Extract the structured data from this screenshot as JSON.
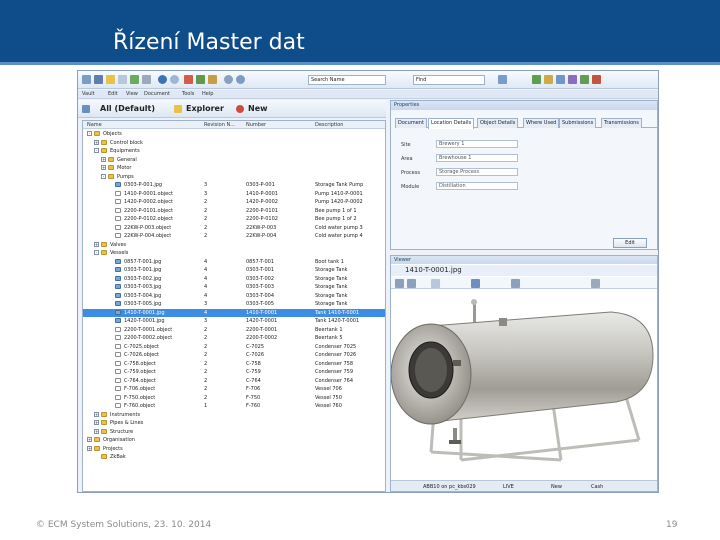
{
  "slide": {
    "title": "Řízení Master dat",
    "footer": "© ECM System Solutions, 23. 10. 2014",
    "page_number": "19"
  },
  "app": {
    "toolbar": {
      "search_mode": "Search Name",
      "search_value": "Find"
    },
    "menu": [
      "Vault",
      "Edit",
      "View",
      "Document",
      "Tools",
      "Help"
    ],
    "explorer_bar": {
      "filter": "All (Default)",
      "explorer_label": "Explorer",
      "new_label": "New"
    },
    "tree": {
      "columns": [
        "Name",
        "Revision N...",
        "Number",
        "Description"
      ],
      "rows": [
        {
          "indent": 1,
          "icon": "folder",
          "expand": "-",
          "name": "Objects",
          "rev": "",
          "num": "",
          "desc": ""
        },
        {
          "indent": 2,
          "icon": "folder",
          "expand": "+",
          "name": "Control block",
          "rev": "",
          "num": "",
          "desc": ""
        },
        {
          "indent": 2,
          "icon": "folder",
          "expand": "-",
          "name": "Equipments",
          "rev": "",
          "num": "",
          "desc": ""
        },
        {
          "indent": 3,
          "icon": "folder",
          "expand": "+",
          "name": "General",
          "rev": "",
          "num": "",
          "desc": ""
        },
        {
          "indent": 3,
          "icon": "folder",
          "expand": "+",
          "name": "Motor",
          "rev": "",
          "num": "",
          "desc": ""
        },
        {
          "indent": 3,
          "icon": "folder",
          "expand": "-",
          "name": "Pumps",
          "rev": "",
          "num": "",
          "desc": ""
        },
        {
          "indent": 4,
          "icon": "img",
          "expand": "",
          "name": "0303-P-001.jpg",
          "rev": "3",
          "num": "0303-P-001",
          "desc": "Storage Tank Pump"
        },
        {
          "indent": 4,
          "icon": "file",
          "expand": "",
          "name": "1410-P-0001.object",
          "rev": "3",
          "num": "1410-P-0001",
          "desc": "Pump 1410-P-0001"
        },
        {
          "indent": 4,
          "icon": "file",
          "expand": "",
          "name": "1420-P-0002.object",
          "rev": "2",
          "num": "1420-P-0002",
          "desc": "Pump 1420-P-0002"
        },
        {
          "indent": 4,
          "icon": "file",
          "expand": "",
          "name": "2200-P-0101.object",
          "rev": "2",
          "num": "2200-P-0101",
          "desc": "Bee pump 1 of 1"
        },
        {
          "indent": 4,
          "icon": "file",
          "expand": "",
          "name": "2200-P-0102.object",
          "rev": "2",
          "num": "2200-P-0102",
          "desc": "Bee pump 1 of 2"
        },
        {
          "indent": 4,
          "icon": "file",
          "expand": "",
          "name": "22KW-P-003.object",
          "rev": "2",
          "num": "22KW-P-003",
          "desc": "Cold water pump 3"
        },
        {
          "indent": 4,
          "icon": "file",
          "expand": "",
          "name": "22KW-P-004.object",
          "rev": "2",
          "num": "22KW-P-004",
          "desc": "Cold water pump 4"
        },
        {
          "indent": 2,
          "icon": "folder",
          "expand": "+",
          "name": "Valves",
          "rev": "",
          "num": "",
          "desc": ""
        },
        {
          "indent": 2,
          "icon": "folder",
          "expand": "-",
          "name": "Vessels",
          "rev": "",
          "num": "",
          "desc": ""
        },
        {
          "indent": 4,
          "icon": "img",
          "expand": "",
          "name": "0857-T-001.jpg",
          "rev": "4",
          "num": "0857-T-001",
          "desc": "Boot tank 1"
        },
        {
          "indent": 4,
          "icon": "img",
          "expand": "",
          "name": "0303-T-001.jpg",
          "rev": "4",
          "num": "0303-T-001",
          "desc": "Storage Tank"
        },
        {
          "indent": 4,
          "icon": "img",
          "expand": "",
          "name": "0303-T-002.jpg",
          "rev": "4",
          "num": "0303-T-002",
          "desc": "Storage Tank"
        },
        {
          "indent": 4,
          "icon": "img",
          "expand": "",
          "name": "0303-T-003.jpg",
          "rev": "4",
          "num": "0303-T-003",
          "desc": "Storage Tank"
        },
        {
          "indent": 4,
          "icon": "img",
          "expand": "",
          "name": "0303-T-004.jpg",
          "rev": "4",
          "num": "0303-T-004",
          "desc": "Storage Tank"
        },
        {
          "indent": 4,
          "icon": "img",
          "expand": "",
          "name": "0303-T-005.jpg",
          "rev": "3",
          "num": "0303-T-005",
          "desc": "Storage Tank"
        },
        {
          "indent": 4,
          "icon": "img",
          "expand": "",
          "name": "1410-T-0001.jpg",
          "rev": "4",
          "num": "1410-T-0001",
          "desc": "Tank 1410-T-0001",
          "selected": true
        },
        {
          "indent": 4,
          "icon": "img",
          "expand": "",
          "name": "1420-T-0001.jpg",
          "rev": "3",
          "num": "1420-T-0001",
          "desc": "Tank 1420-T-0001"
        },
        {
          "indent": 4,
          "icon": "file",
          "expand": "",
          "name": "2200-T-0001.object",
          "rev": "2",
          "num": "2200-T-0001",
          "desc": "Beertank 1"
        },
        {
          "indent": 4,
          "icon": "file",
          "expand": "",
          "name": "2200-T-0002.object",
          "rev": "2",
          "num": "2200-T-0002",
          "desc": "Beertank 5"
        },
        {
          "indent": 4,
          "icon": "file",
          "expand": "",
          "name": "C-7025.object",
          "rev": "2",
          "num": "C-7025",
          "desc": "Condenser 7025"
        },
        {
          "indent": 4,
          "icon": "file",
          "expand": "",
          "name": "C-7026.object",
          "rev": "2",
          "num": "C-7026",
          "desc": "Condenser 7026"
        },
        {
          "indent": 4,
          "icon": "file",
          "expand": "",
          "name": "C-758.object",
          "rev": "2",
          "num": "C-758",
          "desc": "Condenser 758"
        },
        {
          "indent": 4,
          "icon": "file",
          "expand": "",
          "name": "C-759.object",
          "rev": "2",
          "num": "C-759",
          "desc": "Condenser 759"
        },
        {
          "indent": 4,
          "icon": "file",
          "expand": "",
          "name": "C-764.object",
          "rev": "2",
          "num": "C-764",
          "desc": "Condenser 764"
        },
        {
          "indent": 4,
          "icon": "file",
          "expand": "",
          "name": "F-706.object",
          "rev": "2",
          "num": "F-706",
          "desc": "Vessel 706"
        },
        {
          "indent": 4,
          "icon": "file",
          "expand": "",
          "name": "F-750.object",
          "rev": "2",
          "num": "F-750",
          "desc": "Vessel 750"
        },
        {
          "indent": 4,
          "icon": "file",
          "expand": "",
          "name": "F-760.object",
          "rev": "1",
          "num": "F-760",
          "desc": "Vessel 760"
        },
        {
          "indent": 2,
          "icon": "folder",
          "expand": "+",
          "name": "Instruments",
          "rev": "",
          "num": "",
          "desc": ""
        },
        {
          "indent": 2,
          "icon": "folder",
          "expand": "+",
          "name": "Pipes & Lines",
          "rev": "",
          "num": "",
          "desc": ""
        },
        {
          "indent": 2,
          "icon": "folder",
          "expand": "+",
          "name": "Structure",
          "rev": "",
          "num": "",
          "desc": ""
        },
        {
          "indent": 1,
          "icon": "folder",
          "expand": "+",
          "name": "Organisation",
          "rev": "",
          "num": "",
          "desc": ""
        },
        {
          "indent": 1,
          "icon": "folder",
          "expand": "+",
          "name": "Projects",
          "rev": "",
          "num": "",
          "desc": ""
        },
        {
          "indent": 2,
          "icon": "folder",
          "expand": "",
          "name": "ZkBak",
          "rev": "",
          "num": "",
          "desc": ""
        }
      ]
    },
    "properties": {
      "title": "Properties",
      "tabs": [
        "Document",
        "Location Details",
        "Object Details",
        "Where Used",
        "Submissions",
        "Transmissions"
      ],
      "active_tab": 1,
      "fields": [
        {
          "label": "Site",
          "value": "Brewery 1"
        },
        {
          "label": "Area",
          "value": "Brewhouse 1"
        },
        {
          "label": "Process",
          "value": "Storage Process"
        },
        {
          "label": "Module",
          "value": "Distillation"
        }
      ],
      "edit_button": "Edit"
    },
    "viewer": {
      "title": "Viewer",
      "file_name": "1410-T-0001.jpg",
      "status_left": "ABB10 on pc_kbs029",
      "status_mid": "LIVE",
      "status_new": "New",
      "status_user": "Cash"
    }
  },
  "colors": {
    "title_band": "#0f4c8a",
    "selection": "#3d8ee3"
  }
}
